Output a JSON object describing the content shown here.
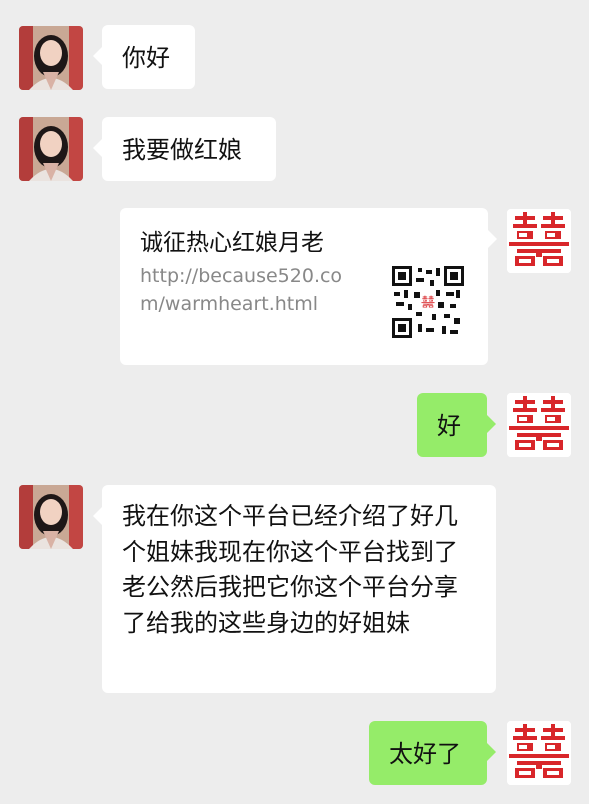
{
  "messages": {
    "m1": "你好",
    "m2": "我要做红娘",
    "m3_title": "诚征热心红娘月老",
    "m3_url": "http://because520.com/warmheart.html",
    "m4": "好",
    "m5": "我在你这个平台已经介绍了好几个姐妹我现在你这个平台找到了老公然后我把它你这个平台分享了给我的这些身边的好姐妹",
    "m6": "太好了"
  },
  "icons": {
    "left_avatar": "woman-photo-avatar",
    "right_avatar": "double-happiness-avatar",
    "qr": "qr-code-icon"
  },
  "colors": {
    "background": "#ededed",
    "incoming": "#ffffff",
    "outgoing": "#95ec69",
    "accent_red": "#d8262a"
  }
}
